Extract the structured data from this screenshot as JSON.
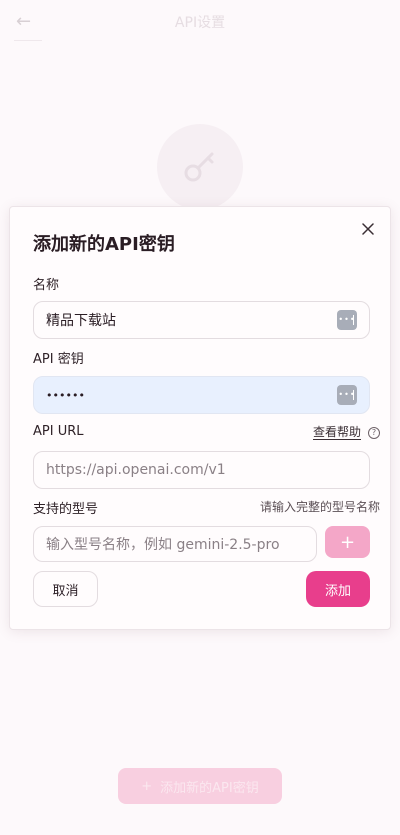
{
  "background": {
    "header_title": "API设置",
    "back_glyph": "←",
    "bottom_button_label": "添加新的API密钥"
  },
  "dialog": {
    "title": "添加新的API密钥",
    "close_glyph": "×",
    "name_field": {
      "label": "名称",
      "value": "精品下载站"
    },
    "key_field": {
      "label": "API 密钥",
      "value": "••••••"
    },
    "url_field": {
      "label": "API URL",
      "help_link": "查看帮助",
      "help_icon_glyph": "?",
      "placeholder": "https://api.openai.com/v1"
    },
    "models_field": {
      "label": "支持的型号",
      "hint": "请输入完整的型号名称",
      "placeholder": "输入型号名称，例如 gemini-2.5-pro",
      "add_glyph": "+"
    },
    "cancel_label": "取消",
    "submit_label": "添加"
  },
  "colors": {
    "accent": "#e83e8c",
    "accent_light": "#f4a7c8",
    "autofill_bg": "#e8f0fe"
  },
  "icons": {
    "close": "close-icon",
    "password_manager": "password-manager-icon",
    "help": "help-circle-icon",
    "key": "key-icon",
    "back": "back-arrow-icon"
  }
}
